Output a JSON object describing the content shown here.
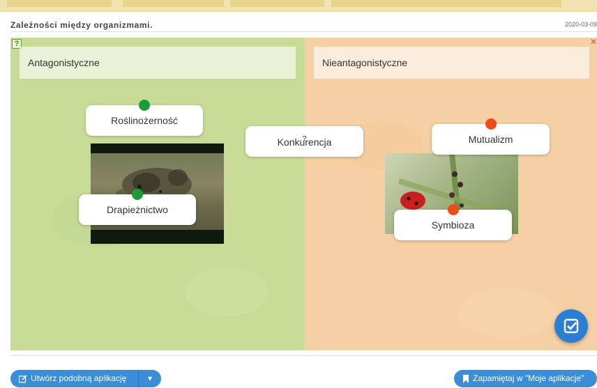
{
  "page": {
    "title": "Zależności między organizmami.",
    "date": "2020-03-09"
  },
  "board": {
    "left_header": "Antagonistyczne",
    "right_header": "Nieantagonistyczne",
    "cards": [
      {
        "label": "Roślinożerność",
        "dot": "green"
      },
      {
        "label": "Drapieżnictwo",
        "dot": "green"
      },
      {
        "label": "Konkurencja",
        "dot": "none",
        "hint": "?"
      },
      {
        "label": "Mutualizm",
        "dot": "red"
      },
      {
        "label": "Symbioza",
        "dot": "red"
      }
    ],
    "colors": {
      "left_bg": "#c8dc98",
      "right_bg": "#f6d0a5",
      "correct": "#1c9c3a",
      "wrong": "#ef4a1c",
      "accent": "#2b7fd3"
    },
    "icons": {
      "help": "help-icon",
      "close": "close-icon",
      "check": "check-icon"
    }
  },
  "footer": {
    "create_similar": "Utwórz podobną aplikację",
    "remember": "Zapamiętaj w \"Moje aplikacje\""
  }
}
